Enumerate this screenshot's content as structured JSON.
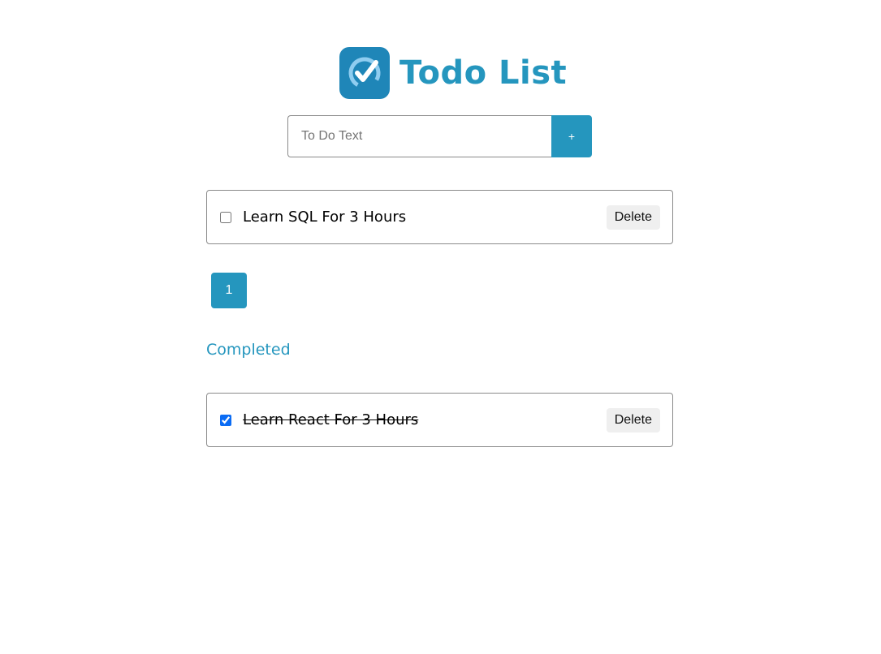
{
  "header": {
    "title": "Todo List",
    "logo_icon": "check-circle-icon",
    "brand_color": "#2596be"
  },
  "form": {
    "input_placeholder": "To Do Text",
    "input_value": "",
    "add_label": "+"
  },
  "active_todos": [
    {
      "text": "Learn SQL For 3 Hours",
      "checked": false,
      "delete_label": "Delete"
    }
  ],
  "pagination": {
    "current_page": "1"
  },
  "completed": {
    "heading": "Completed",
    "todos": [
      {
        "text": "Learn React For 3 Hours",
        "checked": true,
        "delete_label": "Delete"
      }
    ]
  }
}
